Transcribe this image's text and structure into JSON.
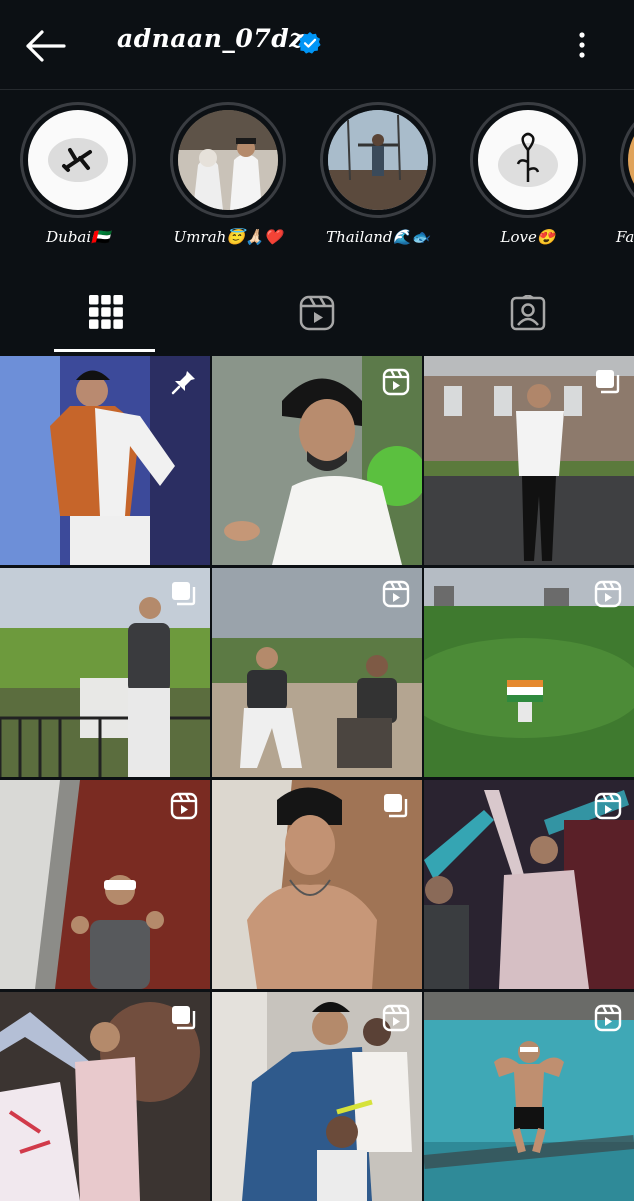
{
  "header": {
    "username": "adnaan_07dz",
    "verified": true,
    "back_icon": "arrow-left-icon",
    "more_icon": "more-vertical-icon"
  },
  "highlights": [
    {
      "label": "Dubai🇦🇪",
      "icon": "airplane-icon"
    },
    {
      "label": "Umrah😇🙏🏻❤️",
      "icon": "photo"
    },
    {
      "label": "Thailand🌊🐟",
      "icon": "photo"
    },
    {
      "label": "Love😍",
      "icon": "rose-icon"
    },
    {
      "label": "Fa",
      "icon": "photo"
    }
  ],
  "tabs": [
    {
      "name": "posts",
      "icon": "grid-icon",
      "active": true
    },
    {
      "name": "reels",
      "icon": "reels-icon",
      "active": false
    },
    {
      "name": "tagged",
      "icon": "tagged-user-icon",
      "active": false
    }
  ],
  "posts": [
    {
      "badge": "pin-icon"
    },
    {
      "badge": "reel-icon"
    },
    {
      "badge": "carousel-icon"
    },
    {
      "badge": "carousel-icon"
    },
    {
      "badge": "reel-icon"
    },
    {
      "badge": "reel-icon"
    },
    {
      "badge": "reel-icon"
    },
    {
      "badge": "carousel-icon"
    },
    {
      "badge": "reel-icon"
    },
    {
      "badge": "carousel-icon"
    },
    {
      "badge": "reel-icon"
    },
    {
      "badge": "reel-icon"
    }
  ],
  "colors": {
    "background": "#0c1014",
    "verified_blue": "#0095f6",
    "ring": "#3a3d42"
  }
}
